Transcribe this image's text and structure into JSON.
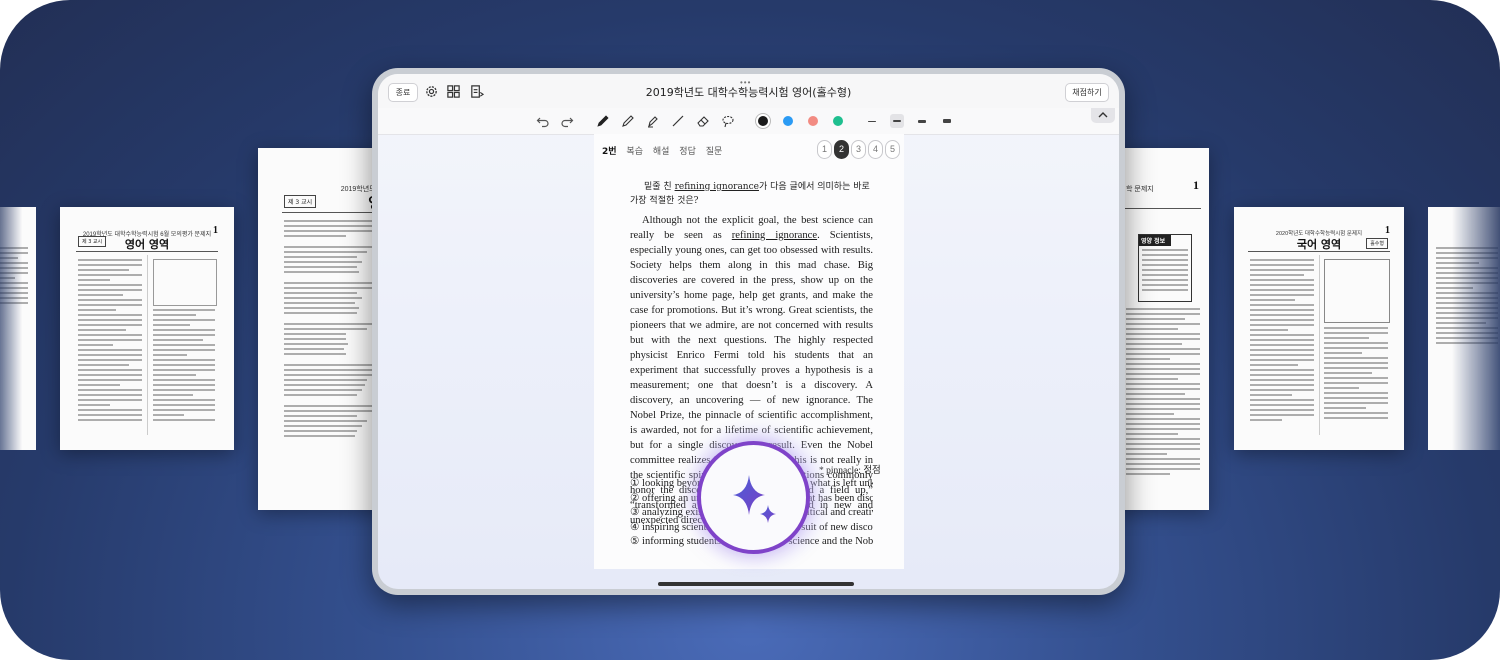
{
  "app": {
    "window_title": "2019학년도 대학수학능력시험 영어(홀수형)",
    "end_button": "종료",
    "grade_button": "채점하기",
    "icons": [
      "settings-icon",
      "grid-icon",
      "document-icon"
    ]
  },
  "toolbar": {
    "tools": [
      "undo-icon",
      "redo-icon",
      "pen-icon",
      "pencil-icon",
      "highlighter-icon",
      "line-icon",
      "eraser-icon",
      "lasso-icon"
    ],
    "colors": [
      "#1a1a1a",
      "#2b9bf4",
      "#f28b82",
      "#1fbf8f"
    ],
    "selected_color": "#1a1a1a",
    "thickness_options": 4,
    "selected_thickness": 2
  },
  "panel": {
    "current_question": "2번",
    "tabs": [
      "복습",
      "해설",
      "정답",
      "질문"
    ],
    "pages": [
      "1",
      "2",
      "3",
      "4",
      "5"
    ],
    "active_page": "2"
  },
  "question": {
    "prompt_pre": "밑줄 친 ",
    "prompt_underlined": "refining ignorance",
    "prompt_post": "가 다음 글에서 의미하는 바로 가장 적절한 것은?",
    "passage_1": "Although not the explicit goal, the best science can really be seen as ",
    "passage_underlined": "refining ignorance",
    "passage_2": ". Scientists, especially young ones, can get too obsessed with results. Society helps them along in this mad chase. Big discoveries are covered in the press, show up on the university’s home page, help get grants, and make the case for promotions. But it’s wrong. Great scientists, the pioneers that we admire, are not concerned with results but with the next questions. The highly respected physicist Enrico Fermi told his students that an experiment that successfully proves a hypothesis is a measurement; one that doesn’t is a discovery. A discovery, an uncovering — of new ignorance. The Nobel Prize, the pinnacle of scientific accomplishment, is awarded, not for a lifetime of scientific achievement, but for a single discovery, a result. Even the Nobel committee realizes in some way that this is not really in the scientific spirit, and their award citations commonly honor the discovery for having “opened a field up,” “transformed a field,” or “taken a field in new and unexpected directions.”",
    "footnote": "* pinnacle: 정점",
    "choices": [
      "① looking beyond what is known towards what is left unknown",
      "② offering an untested explanation for what has been discovered",
      "③ analyzing existing knowledge with a critical and creative mindset",
      "④ inspiring scientists to take risks in pursuit of new discoveries",
      "⑤ informing students of the limits of science and the Nobel Prize"
    ]
  },
  "background_pages": {
    "left_outer_title": "2019학년도 대학수학능력시험 6월 모의평가 문제지",
    "left_outer_subject": "영어 영역",
    "left_outer_session": "제 3 교시",
    "left_outer_page": "1",
    "left_center_header": "2019학년도 대",
    "left_center_title": "영",
    "left_center_session": "제 3 교시",
    "right_center_header": "학 문제지",
    "right_center_page": "1",
    "right_center_box": "영양 정보",
    "right_outer_header": "2020학년도 대학수학능력시험 문제지",
    "right_outer_subject": "국어 영역",
    "right_outer_badge": "홀수형",
    "right_outer_page": "1"
  },
  "ai_button": "sparkle-icon"
}
